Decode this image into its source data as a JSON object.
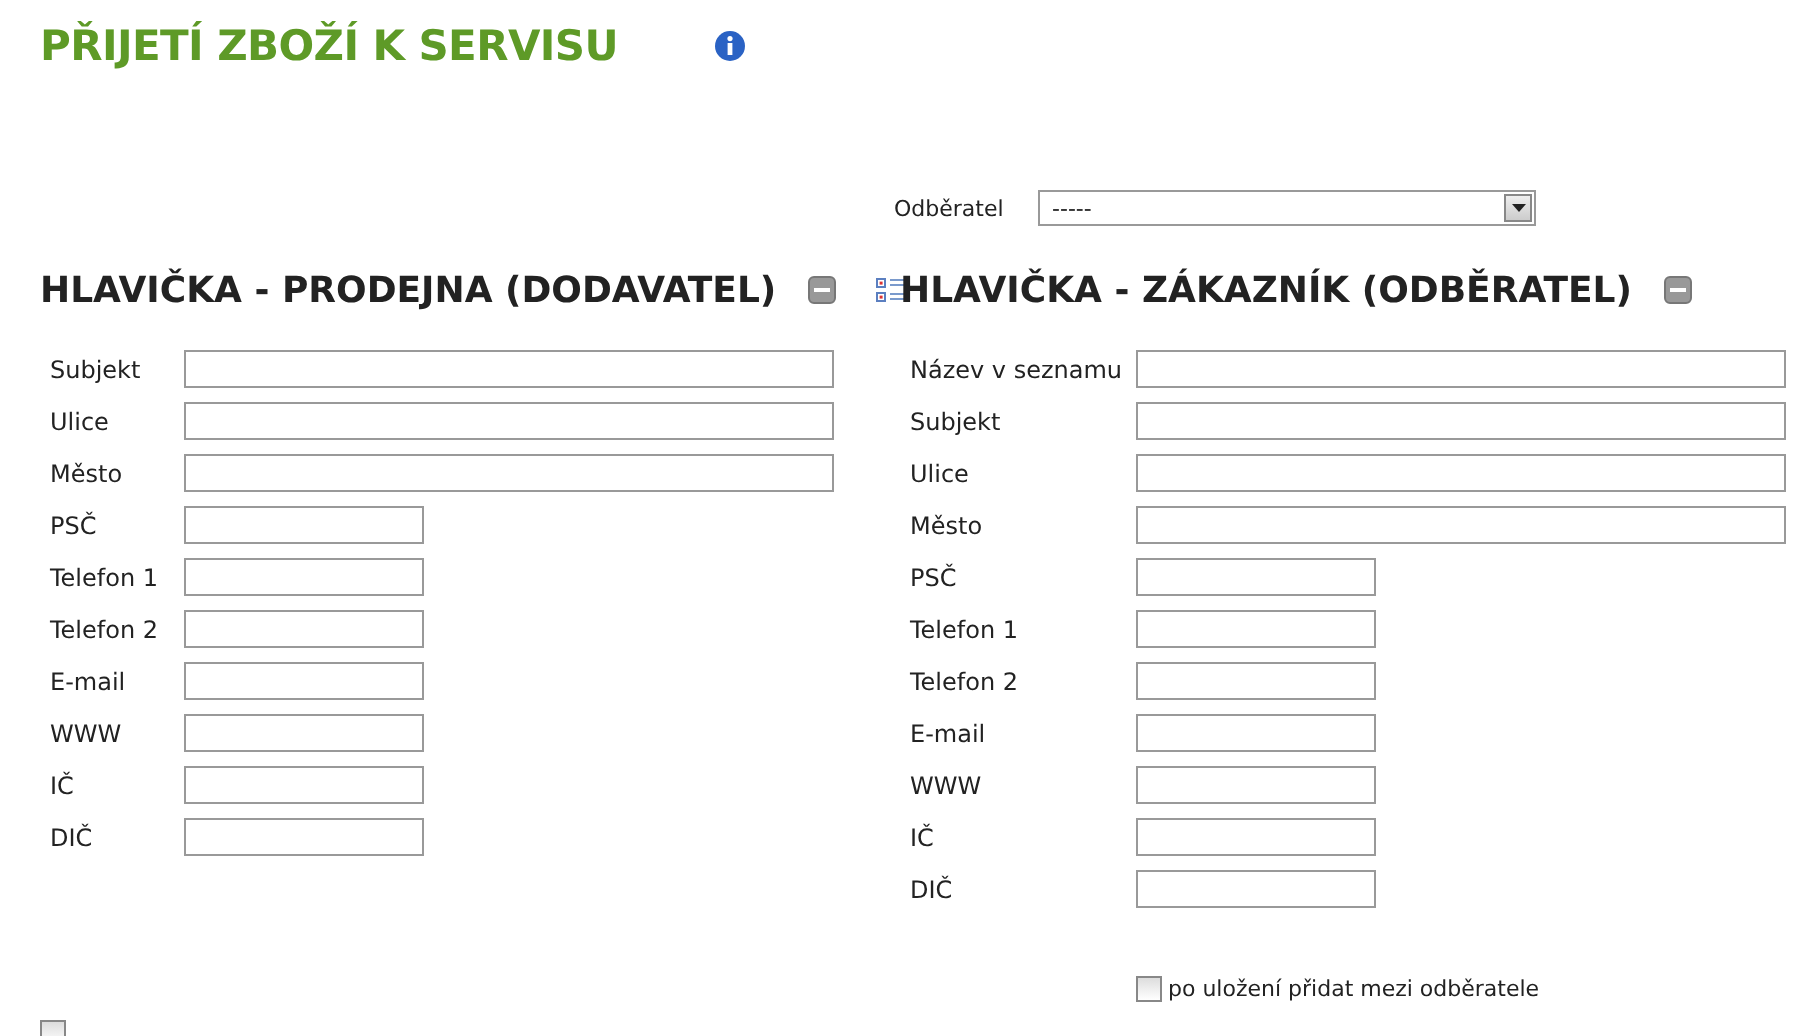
{
  "title": "PŘIJETÍ ZBOŽÍ K SERVISU",
  "customer_select": {
    "label": "Odběratel",
    "value": "-----"
  },
  "supplier_section": {
    "heading": "HLAVIČKA - PRODEJNA (DODAVATEL)",
    "fields": [
      {
        "label": "Subjekt",
        "kind": "wide"
      },
      {
        "label": "Ulice",
        "kind": "wide"
      },
      {
        "label": "Město",
        "kind": "wide"
      },
      {
        "label": "PSČ",
        "kind": "short"
      },
      {
        "label": "Telefon 1",
        "kind": "short"
      },
      {
        "label": "Telefon 2",
        "kind": "short"
      },
      {
        "label": "E-mail",
        "kind": "short"
      },
      {
        "label": "WWW",
        "kind": "short"
      },
      {
        "label": "IČ",
        "kind": "short"
      },
      {
        "label": "DIČ",
        "kind": "short"
      }
    ]
  },
  "customer_section": {
    "heading": "HLAVIČKA - ZÁKAZNÍK (ODBĚRATEL)",
    "fields": [
      {
        "label": "Název v seznamu",
        "kind": "wide"
      },
      {
        "label": "Subjekt",
        "kind": "wide"
      },
      {
        "label": "Ulice",
        "kind": "wide"
      },
      {
        "label": "Město",
        "kind": "wide"
      },
      {
        "label": "PSČ",
        "kind": "short"
      },
      {
        "label": "Telefon 1",
        "kind": "short"
      },
      {
        "label": "Telefon 2",
        "kind": "short"
      },
      {
        "label": "E-mail",
        "kind": "short"
      },
      {
        "label": "WWW",
        "kind": "short"
      },
      {
        "label": "IČ",
        "kind": "short"
      },
      {
        "label": "DIČ",
        "kind": "short"
      }
    ],
    "add_to_customers": {
      "label": "po uložení přidat mezi odběratele",
      "checked": false
    }
  },
  "bottom_checkbox": {
    "checked": false
  }
}
